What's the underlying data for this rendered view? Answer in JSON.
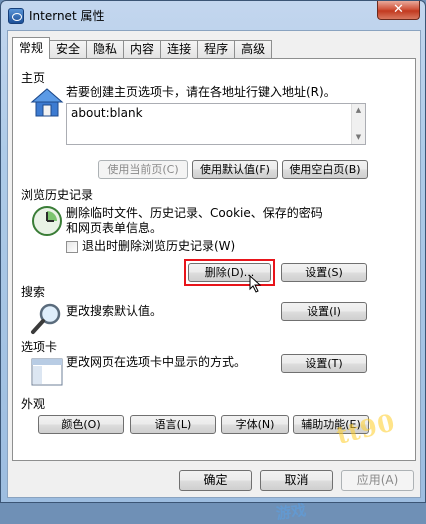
{
  "window": {
    "title": "Internet 属性",
    "close_glyph": "✕"
  },
  "tabs": [
    {
      "label": "常规",
      "active": true
    },
    {
      "label": "安全"
    },
    {
      "label": "隐私"
    },
    {
      "label": "内容"
    },
    {
      "label": "连接"
    },
    {
      "label": "程序"
    },
    {
      "label": "高级"
    }
  ],
  "home": {
    "title": "主页",
    "desc": "若要创建主页选项卡，请在各地址行键入地址(R)。",
    "url": "about:blank",
    "use_current": "使用当前页(C)",
    "use_default": "使用默认值(F)",
    "use_blank": "使用空白页(B)"
  },
  "history": {
    "title": "浏览历史记录",
    "desc": "删除临时文件、历史记录、Cookie、保存的密码和网页表单信息。",
    "checkbox_label": "退出时删除浏览历史记录(W)",
    "checkbox_checked": false,
    "delete_btn": "删除(D)...",
    "settings_btn": "设置(S)"
  },
  "search": {
    "title": "搜索",
    "desc": "更改搜索默认值。",
    "settings_btn": "设置(I)"
  },
  "tabs_section": {
    "title": "选项卡",
    "desc": "更改网页在选项卡中显示的方式。",
    "settings_btn": "设置(T)"
  },
  "appearance": {
    "title": "外观",
    "colors_btn": "颜色(O)",
    "languages_btn": "语言(L)",
    "fonts_btn": "字体(N)",
    "accessibility_btn": "辅助功能(E)"
  },
  "footer": {
    "ok": "确定",
    "cancel": "取消",
    "apply": "应用(A)"
  },
  "watermark": {
    "text": "tt90",
    "text2": "游戏"
  },
  "colors": {
    "highlight_border": "#e8141a",
    "titlebar_close": "#c23a20",
    "accent_blue": "#1c4f98"
  },
  "icons": [
    "internet-options-icon",
    "home-icon",
    "history-clock-icon",
    "search-magnifier-icon",
    "tabs-window-icon",
    "close-icon",
    "scroll-up-icon",
    "scroll-down-icon",
    "mouse-cursor-icon"
  ]
}
